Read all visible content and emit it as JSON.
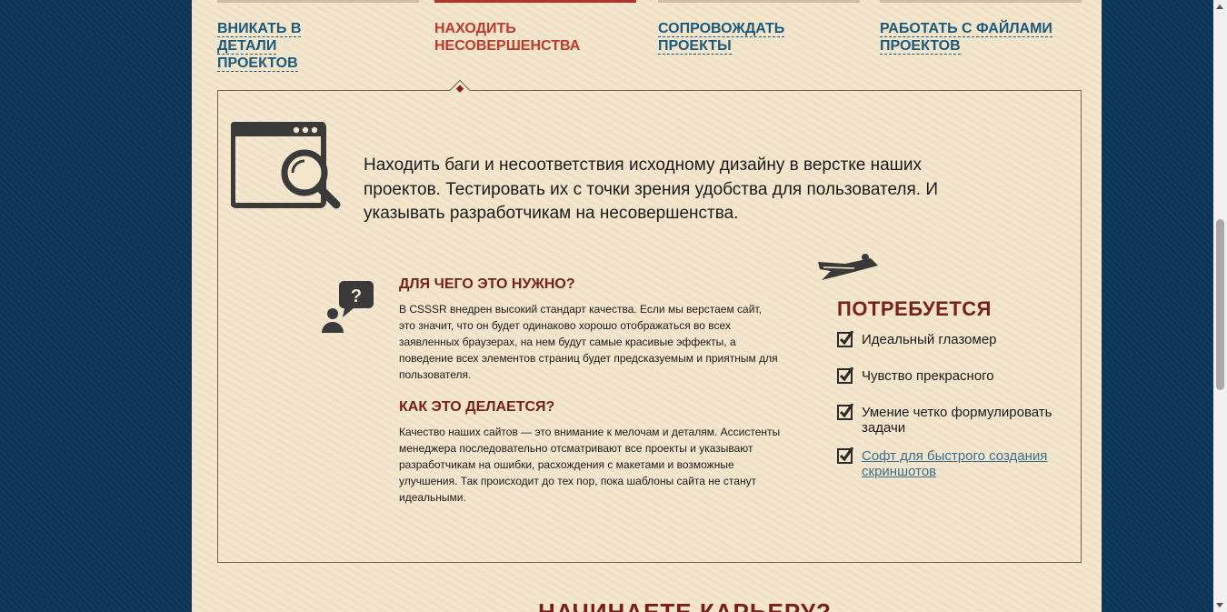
{
  "tabs": [
    {
      "label": "ВНИКАТЬ В ДЕТАЛИ ПРОЕКТОВ",
      "active": false
    },
    {
      "label": "НАХОДИТЬ НЕСОВЕРШЕНСТВА",
      "active": true
    },
    {
      "label": "СОПРОВОЖДАТЬ ПРОЕКТЫ",
      "active": false
    },
    {
      "label": "РАБОТАТЬ С ФАЙЛАМИ ПРОЕКТОВ",
      "active": false
    }
  ],
  "card": {
    "main_icon": "browser-magnifier-icon",
    "intro": "Находить баги и несоответствия исходному дизайну в верстке наших проектов. Тестировать их с точки зрения удобства для пользователя. И указывать разработчикам на несовершенства.",
    "why_icon": "person-question-icon",
    "why_title": "ДЛЯ ЧЕГО ЭТО НУЖНО?",
    "why_text": "В CSSSR внедрен высокий стандарт качества. Если мы верстаем сайт, это значит, что он будет одинаково хорошо отображаться во всех заявленных браузерах, на нем будут самые красивые эффекты, а поведение всех элементов страниц будет предсказуемым и приятным для пользователя.",
    "how_title": "КАК ЭТО ДЕЛАЕТСЯ?",
    "how_text": "Качество наших сайтов — это внимание к мелочам и деталям. Ассистенты менеджера последовательно отсматривают все проекты и указывают разработчикам на ошибки, расхождения с макетами и возможные улучшения. Так происходит до тех пор, пока шаблоны сайта не станут идеальными.",
    "plane_icon": "flying-person-icon",
    "requirements_title": "ПОТРЕБУЕТСЯ",
    "requirements": [
      {
        "text": "Идеальный глазомер",
        "link": false
      },
      {
        "text": "Чувство прекрасного",
        "link": false
      },
      {
        "text": "Умение четко формулировать задачи",
        "link": false
      },
      {
        "text": "Софт для быстрого создания скриншотов",
        "link": true
      }
    ]
  },
  "next_heading": "НАЧИНАЕТЕ КАРЬЕРУ?"
}
